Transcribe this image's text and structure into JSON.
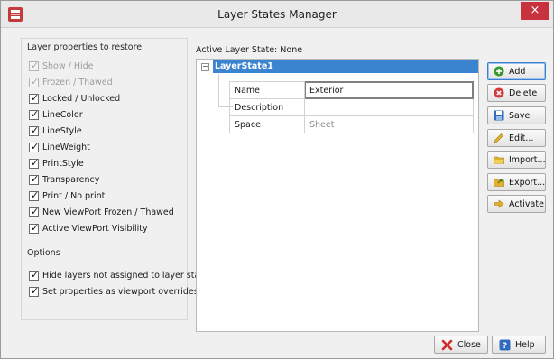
{
  "window": {
    "title": "Layer States Manager",
    "close_glyph": "×"
  },
  "restore": {
    "label": "Layer properties to restore",
    "items": [
      {
        "label": "Show / Hide",
        "checked": true,
        "disabled": true
      },
      {
        "label": "Frozen / Thawed",
        "checked": true,
        "disabled": true
      },
      {
        "label": "Locked / Unlocked",
        "checked": true,
        "disabled": false
      },
      {
        "label": "LineColor",
        "checked": true,
        "disabled": false
      },
      {
        "label": "LineStyle",
        "checked": true,
        "disabled": false
      },
      {
        "label": "LineWeight",
        "checked": true,
        "disabled": false
      },
      {
        "label": "PrintStyle",
        "checked": true,
        "disabled": false
      },
      {
        "label": "Transparency",
        "checked": true,
        "disabled": false
      },
      {
        "label": "Print / No print",
        "checked": true,
        "disabled": false
      },
      {
        "label": "New ViewPort Frozen / Thawed",
        "checked": true,
        "disabled": false
      },
      {
        "label": "Active ViewPort Visibility",
        "checked": true,
        "disabled": false
      }
    ]
  },
  "options": {
    "label": "Options",
    "items": [
      {
        "label": "Hide layers not assigned to layer state",
        "checked": true
      },
      {
        "label": "Set properties as viewport overrides",
        "checked": true
      }
    ]
  },
  "active_state": {
    "label": "Active Layer State:",
    "value": "None"
  },
  "tree": {
    "expander": "−",
    "node": "LayerState1",
    "properties": [
      {
        "key": "Name",
        "value": "Exterior",
        "editing": true
      },
      {
        "key": "Description",
        "value": "",
        "editing": false
      },
      {
        "key": "Space",
        "value": "Sheet",
        "editing": false
      }
    ]
  },
  "buttons": {
    "add": "Add",
    "delete": "Delete",
    "save": "Save",
    "edit": "Edit...",
    "import": "Import...",
    "export": "Export...",
    "activate": "Activate",
    "close": "Close",
    "help": "Help"
  },
  "colors": {
    "selection": "#3b84cf",
    "add_icon": "#3a9a2f",
    "delete_icon": "#d23b3b",
    "save_icon": "#2f6cc0",
    "folder_icon": "#e3b22a",
    "close_icon": "#d22b2b",
    "help_icon": "#2f6cc0"
  }
}
